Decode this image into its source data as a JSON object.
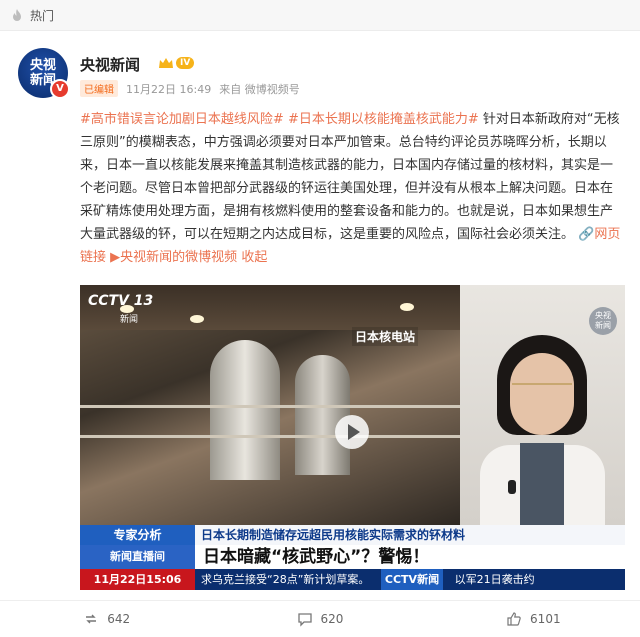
{
  "topbar": {
    "label": "热门",
    "icon": "fire-icon"
  },
  "post": {
    "avatar_text_line1": "央视",
    "avatar_text_line2": "新闻",
    "verified_mark": "V",
    "author": "央视新闻",
    "level_tag": "IV",
    "badge": "已编辑",
    "date": "11月22日 16:49",
    "source": "来自 微博视频号"
  },
  "content": {
    "tag1": "#高市错误言论加剧日本越线风险#",
    "tag2": "#日本长期以核能掩盖核武能力#",
    "text": "针对日本新政府对“无核三原则”的模糊表态，中方强调必须要对日本严加管束。总台特约评论员苏晓晖分析，长期以来，日本一直以核能发展来掩盖其制造核武器的能力，日本国内存储过量的核材料，其实是一个老问题。尽管日本曾把部分武器级的钚运往美国处理，但并没有从根本上解决问题。日本在采矿精炼使用处理方面，是拥有核燃料使用的整套设备和能力的。也就是说，日本如果想生产大量武器级的钚，可以在短期之内达成目标，这是重要的风险点，国际社会必须关注。",
    "link1": "网页链接",
    "link2": "央视新闻的微博视频",
    "collapse": "收起"
  },
  "video": {
    "channel": "CCTV 13",
    "channel_sub": "新闻",
    "location_label": "日本核电站",
    "expert_logo_line1": "央视",
    "expert_logo_line2": "新闻",
    "expert_tag": "专家分析",
    "subhead": "日本长期制造储存远超民用核能实际需求的钚材料",
    "program_tag": "新闻直播间",
    "headline": "日本暗藏“核武野心”？警惕！",
    "time_tag": "11月22日15:06",
    "ticker_left": "求乌克兰接受“28点”新计划草案。",
    "ticker_logo": "CCTV新闻",
    "ticker_right": "以军21日袭击约"
  },
  "actions": {
    "repost": "642",
    "comment": "620",
    "like": "6101"
  },
  "colors": {
    "accent": "#eb7350",
    "news_blue": "#0d3a8a",
    "alert_red": "#c8161d"
  }
}
